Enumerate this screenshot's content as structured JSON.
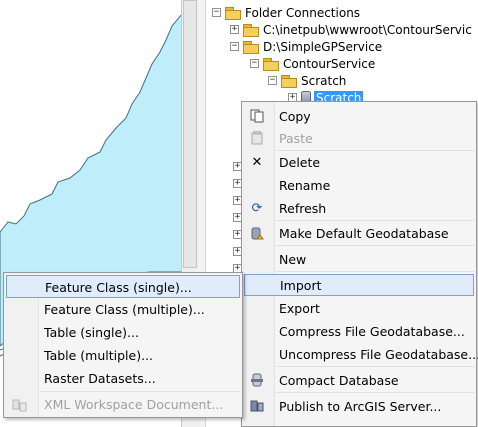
{
  "map": {
    "colors": {
      "polygon_fill": "#bfeefa",
      "polygon_stroke": "#3f6f85"
    }
  },
  "tree": {
    "folder_connections": "Folder Connections",
    "inetpub_path": "C:\\inetpub\\wwwroot\\ContourServic",
    "simplegp_path": "D:\\SimpleGPService",
    "contour_service": "ContourService",
    "scratch_folder": "Scratch",
    "scratch_gdb": "Scratch",
    "expand_minus": "−",
    "expand_plus": "+",
    "colors": {
      "selection": "#3399ff"
    }
  },
  "context_menu": {
    "copy": "Copy",
    "paste": "Paste",
    "delete": "Delete",
    "rename": "Rename",
    "refresh": "Refresh",
    "make_default_gdb": "Make Default Geodatabase",
    "new": "New",
    "import": "Import",
    "export": "Export",
    "compress": "Compress File Geodatabase...",
    "uncompress": "Uncompress File Geodatabase...",
    "compact": "Compact Database",
    "publish": "Publish to ArcGIS Server...",
    "colors": {
      "highlight_fill": "#e0ecfb",
      "highlight_border": "#7da2ce"
    }
  },
  "import_submenu": {
    "feature_class_single": "Feature Class (single)...",
    "feature_class_multiple": "Feature Class (multiple)...",
    "table_single": "Table (single)...",
    "table_multiple": "Table (multiple)...",
    "raster_datasets": "Raster Datasets...",
    "xml_workspace": "XML Workspace Document..."
  }
}
